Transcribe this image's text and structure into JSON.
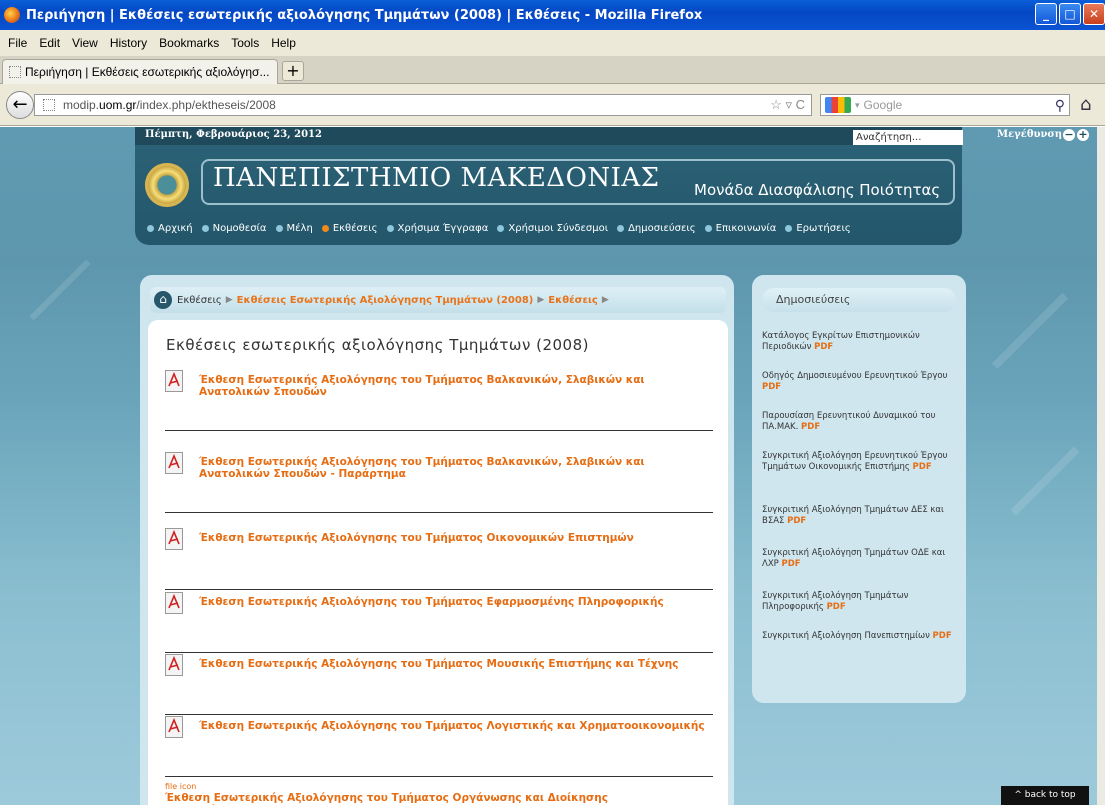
{
  "window": {
    "title": "Περιήγηση | Εκθέσεις εσωτερικής αξιολόγησης Τμημάτων (2008) | Εκθέσεις - Mozilla Firefox",
    "min": "_",
    "max": "□",
    "close": "✕"
  },
  "menu": [
    "File",
    "Edit",
    "View",
    "History",
    "Bookmarks",
    "Tools",
    "Help"
  ],
  "tab": {
    "label": "Περιήγηση | Εκθέσεις εσωτερικής αξιολόγησ...",
    "new": "+"
  },
  "nav": {
    "url_host": "modip.uom.gr",
    "url_path": "/index.php/ektheseis/2008",
    "url_prefix": "modip.",
    "url_domain": "uom.gr",
    "search_placeholder": "Google",
    "url_icons": "☆ ▿ C"
  },
  "site": {
    "date": "Πέμπτη, Φεβρουάριος 23, 2012",
    "search_placeholder": "Αναζήτηση...",
    "zoom_label": "Μεγέθυνση",
    "university": "ΠΑΝΕΠΙΣΤΗΜΙΟ ΜΑΚΕΔΟΝΙΑΣ",
    "unit": "Μονάδα Διασφάλισης Ποιότητας",
    "menu": [
      {
        "label": "Αρχική",
        "active": false
      },
      {
        "label": "Νομοθεσία",
        "active": false
      },
      {
        "label": "Μέλη",
        "active": false
      },
      {
        "label": "Εκθέσεις",
        "active": true
      },
      {
        "label": "Χρήσιμα Έγγραφα",
        "active": false
      },
      {
        "label": "Χρήσιμοι Σύνδεσμοι",
        "active": false
      },
      {
        "label": "Δημοσιεύσεις",
        "active": false
      },
      {
        "label": "Επικοινωνία",
        "active": false
      },
      {
        "label": "Ερωτήσεις",
        "active": false
      }
    ]
  },
  "breadcrumb": [
    "Εκθέσεις",
    "Εκθέσεις Εσωτερικής Αξιολόγησης Τμημάτων (2008)",
    "Εκθέσεις"
  ],
  "article": {
    "title": "Εκθέσεις εσωτερικής αξιολόγησης Τμημάτων (2008)",
    "documents": [
      "Έκθεση Εσωτερικής Αξιολόγησης του Τμήματος Βαλκανικών, Σλαβικών και Ανατολικών Σπουδών",
      "Έκθεση Εσωτερικής Αξιολόγησης του Τμήματος Βαλκανικών, Σλαβικών και Ανατολικών Σπουδών - Παράρτημα",
      "Έκθεση Εσωτερικής Αξιολόγησης του Τμήματος Οικονομικών Επιστημών",
      "Έκθεση Εσωτερικής Αξιολόγησης του Τμήματος Εφαρμοσμένης Πληροφορικής",
      "Έκθεση Εσωτερικής Αξιολόγησης του Τμήματος Μουσικής Επιστήμης και Τέχνης",
      "Έκθεση Εσωτερικής Αξιολόγησης του Τμήματος Λογιστικής και Χρηματοοικονομικής",
      "Έκθεση Εσωτερικής Αξιολόγησης του Τμήματος Οργάνωσης και Διοίκησης Επιχειρήσεων"
    ],
    "broken_icon_text": "file icon"
  },
  "sidebar": {
    "title": "Δημοσιεύσεις",
    "pdf": "PDF",
    "items": [
      "Κατάλογος Εγκρίτων Επιστημονικών Περιοδικών",
      "Οδηγός Δημοσιευμένου Ερευνητικού Έργου",
      "Παρουσίαση Ερευνητικού Δυναμικού του ΠΑ.ΜΑΚ.",
      "Συγκριτική Αξιολόγηση Ερευνητικού Έργου Τμημάτων Οικονομικής Επιστήμης",
      "Συγκριτική Αξιολόγηση Τμημάτων ΔΕΣ και ΒΣΑΣ",
      "Συγκριτική Αξιολόγηση Τμημάτων ΟΔΕ και ΛΧΡ",
      "Συγκριτική Αξιολόγηση Τμημάτων Πληροφορικής",
      "Συγκριτική Αξιολόγηση Πανεπιστημίων"
    ]
  },
  "back_to_top": "^ back to top"
}
